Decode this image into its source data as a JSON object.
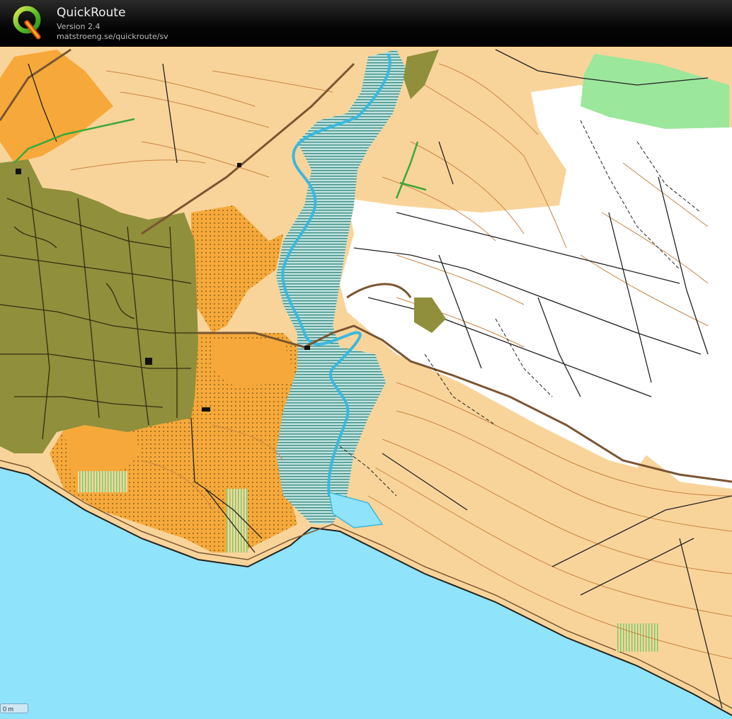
{
  "header": {
    "title": "QuickRoute",
    "version": "Version 2.4",
    "url": "matstroeng.se/quickroute/sv"
  },
  "map": {
    "type": "orienteering-map",
    "colors": {
      "open_land": "#f9d49a",
      "rough_open": "#f6a93a",
      "forest": "#ffffff",
      "urban": "#8f8f3c",
      "green": "#9be79b",
      "marsh": "#9fc7c1",
      "water": "#8fe3fb",
      "contour": "#c98545",
      "path": "#222222",
      "road": "#7a5532"
    }
  },
  "scale_bar": {
    "label": "0 m"
  },
  "icons": {
    "logo": "quickroute-q-logo"
  }
}
